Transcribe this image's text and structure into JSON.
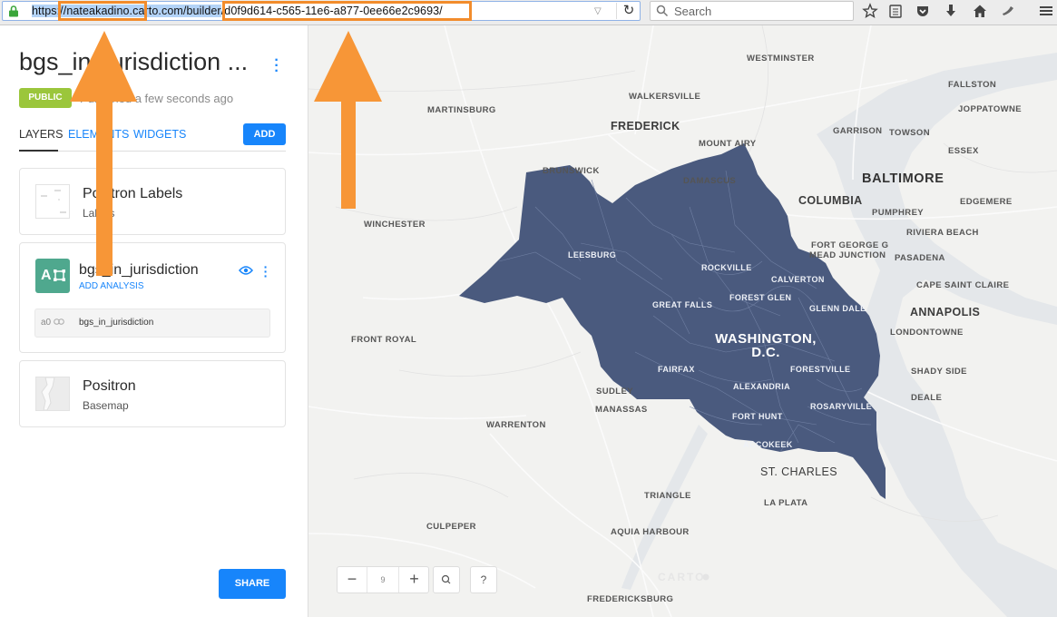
{
  "browser": {
    "url_prefix": "https",
    "url_host": "://nateakadino.carto.com/builder",
    "url_path": "/d0f9d614-c565-11e6-a877-0ee66e2c9693/",
    "search_placeholder": "Search",
    "toolbar_icons": [
      "bookmark-star-icon",
      "reading-list-icon",
      "pocket-icon",
      "download-icon",
      "home-icon",
      "tool-icon",
      "menu-icon"
    ]
  },
  "sidebar": {
    "title": "bgs_in_jurisdiction ...",
    "badge": "PUBLIC",
    "published": "Published a few seconds ago",
    "tabs": [
      {
        "label": "LAYERS"
      },
      {
        "label": "ELEMENTS"
      },
      {
        "label": "WIDGETS"
      }
    ],
    "add_label": "ADD",
    "layers": [
      {
        "title": "Positron Labels",
        "subtitle": "Labels"
      },
      {
        "title": "bgs_in_jurisdiction",
        "letter": "A",
        "action": "ADD ANALYSIS",
        "analysis_id": "a0",
        "analysis_name": "bgs_in_jurisdiction"
      },
      {
        "title": "Positron",
        "subtitle": "Basemap"
      }
    ],
    "share_label": "SHARE"
  },
  "map": {
    "zoom": "9",
    "help": "?",
    "logo": "CARTO",
    "region_color": "#4a5a7e",
    "places": {
      "westminster": "WESTMINSTER",
      "fallston": "FALLSTON",
      "walkersville": "WALKERSVILLE",
      "joppatowne": "JOPPATOWNE",
      "martinsburg": "MARTINSBURG",
      "frederick": "FREDERICK",
      "garrison": "GARRISON",
      "towson": "TOWSON",
      "mount_airy": "MOUNT AIRY",
      "essex": "ESSEX",
      "brunswick": "BRUNSWICK",
      "baltimore": "BALTIMORE",
      "damascus": "DAMASCUS",
      "columbia": "COLUMBIA",
      "edgemere": "EDGEMERE",
      "winchester": "WINCHESTER",
      "pumphrey": "PUMPHREY",
      "riviera_beach": "RIVIERA BEACH",
      "fort_george_g": "FORT GEORGE G",
      "mead_junction": "MEAD JUNCTION",
      "pasadena": "PASADENA",
      "leesburg": "LEESBURG",
      "rockville": "ROCKVILLE",
      "calverton": "CALVERTON",
      "cape_saint_claire": "CAPE SAINT CLAIRE",
      "forest_glen": "FOREST GLEN",
      "great_falls": "GREAT FALLS",
      "glenn_dale": "GLENN DALE",
      "annapolis": "ANNAPOLIS",
      "front_royal": "FRONT ROYAL",
      "londontowne": "LONDONTOWNE",
      "washington": "WASHINGTON,",
      "dc": "D.C.",
      "fairfax": "FAIRFAX",
      "forestville": "FORESTVILLE",
      "shady_side": "SHADY SIDE",
      "alexandria": "ALEXANDRIA",
      "sudley": "SUDLEY",
      "deale": "DEALE",
      "manassas": "MANASSAS",
      "rosaryville": "ROSARYVILLE",
      "fort_hunt": "FORT HUNT",
      "warrenton": "WARRENTON",
      "accokeek": "ACCOKEEK",
      "st_charles": "ST. CHARLES",
      "triangle": "TRIANGLE",
      "la_plata": "LA PLATA",
      "culpeper": "CULPEPER",
      "aquia_harbour": "AQUIA HARBOUR",
      "fredericksburg": "FREDERICKSBURG"
    }
  },
  "annotation_color": "#f28c2c"
}
